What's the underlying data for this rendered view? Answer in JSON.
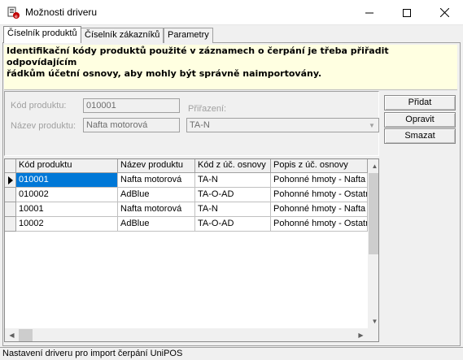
{
  "window": {
    "title": "Možnosti driveru"
  },
  "tabs": [
    {
      "label": "Číselník produktů",
      "active": true
    },
    {
      "label": "Číselník zákazníků",
      "active": false
    },
    {
      "label": "Parametry",
      "active": false
    }
  ],
  "info": {
    "line1": "Identifikační kódy produktů použité v záznamech o čerpání je třeba přiřadit odpovídajícím",
    "line2": "řádkům účetní osnovy, aby mohly být správně naimportovány."
  },
  "form": {
    "product_code_label": "Kód produktu:",
    "product_code_value": "010001",
    "product_name_label": "Název produktu:",
    "product_name_value": "Nafta motorová",
    "assignment_label": "Přiřazení:",
    "assignment_value": "TA-N"
  },
  "buttons": {
    "add": "Přidat",
    "edit": "Opravit",
    "delete": "Smazat"
  },
  "grid": {
    "columns": [
      "Kód produktu",
      "Název produktu",
      "Kód z úč. osnovy",
      "Popis z úč. osnovy"
    ],
    "rows": [
      [
        "010001",
        "Nafta motorová",
        "TA-N",
        "Pohonné hmoty - Nafta"
      ],
      [
        "010002",
        "AdBlue",
        "TA-O-AD",
        "Pohonné hmoty - Ostatní"
      ],
      [
        "10001",
        "Nafta motorová",
        "TA-N",
        "Pohonné hmoty - Nafta"
      ],
      [
        "10002",
        "AdBlue",
        "TA-O-AD",
        "Pohonné hmoty - Ostatní"
      ]
    ],
    "selected_row": 0
  },
  "status": {
    "text": "Nastavení driveru pro import čerpání UniPOS"
  },
  "colors": {
    "info_bg": "#ffffe1",
    "selection": "#0078d7"
  },
  "icons": [
    "app-icon",
    "minimize-icon",
    "maximize-icon",
    "close-icon",
    "row-pointer-icon",
    "chevron-down-icon"
  ]
}
